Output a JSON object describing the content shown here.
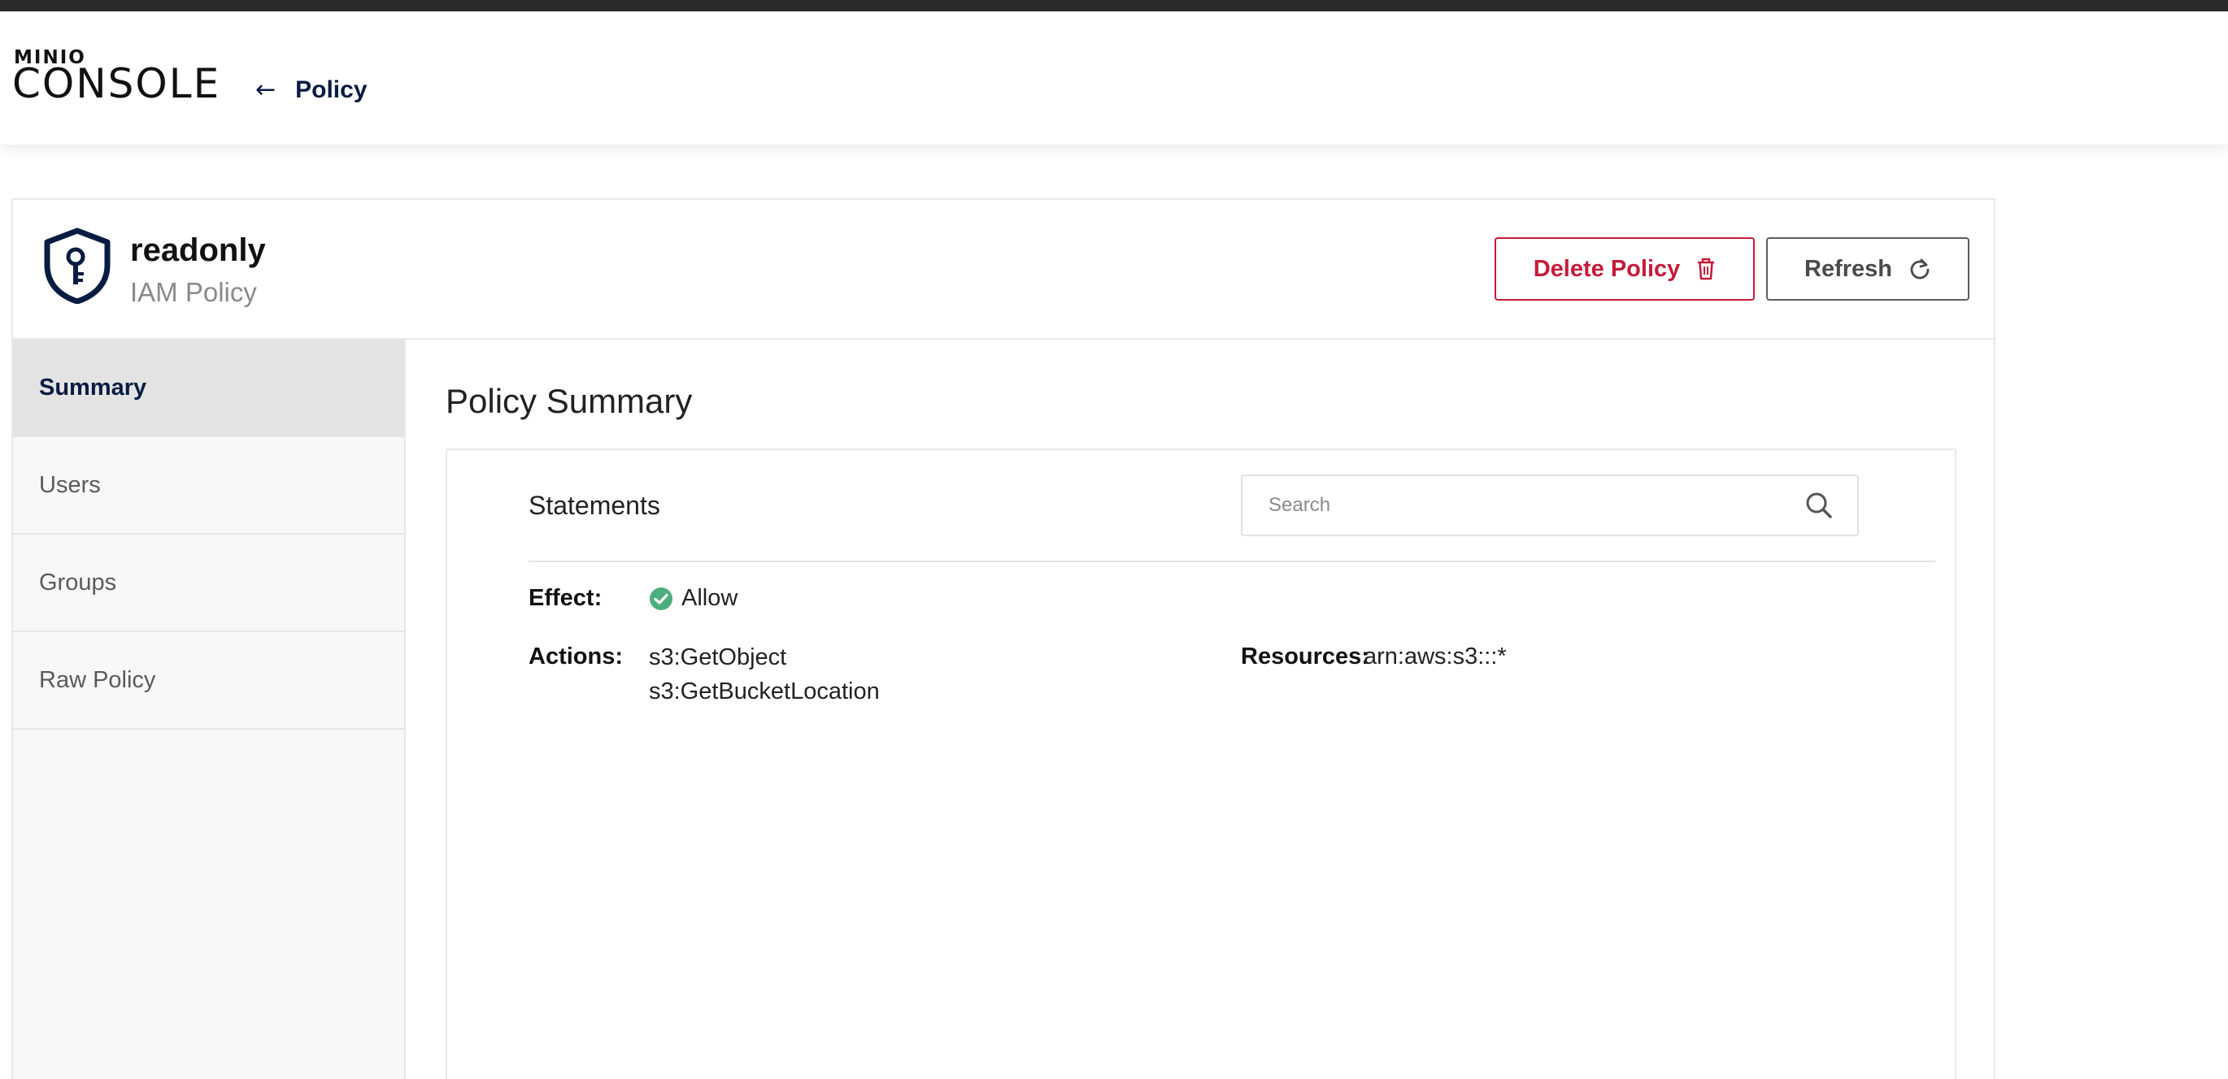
{
  "app": {
    "logo_top": "MINIO",
    "logo_bottom": "CONSOLE",
    "back_label": "Policy"
  },
  "policy": {
    "name": "readonly",
    "type": "IAM Policy",
    "delete_label": "Delete Policy",
    "refresh_label": "Refresh"
  },
  "sidebar": {
    "items": [
      {
        "label": "Summary",
        "active": true
      },
      {
        "label": "Users",
        "active": false
      },
      {
        "label": "Groups",
        "active": false
      },
      {
        "label": "Raw Policy",
        "active": false
      }
    ]
  },
  "summary": {
    "title": "Policy Summary",
    "statements_label": "Statements",
    "search_placeholder": "Search",
    "effect_label": "Effect:",
    "effect_value": "Allow",
    "actions_label": "Actions:",
    "actions": [
      "s3:GetObject",
      "s3:GetBucketLocation"
    ],
    "resources_label": "Resources:",
    "resources_value": "arn:aws:s3:::*"
  },
  "colors": {
    "accent": "#081c42",
    "danger": "#c51b3a",
    "success": "#4caf7d"
  },
  "icons": [
    "arrow-left-icon",
    "shield-key-icon",
    "trash-icon",
    "refresh-icon",
    "search-icon",
    "check-circle-icon"
  ]
}
